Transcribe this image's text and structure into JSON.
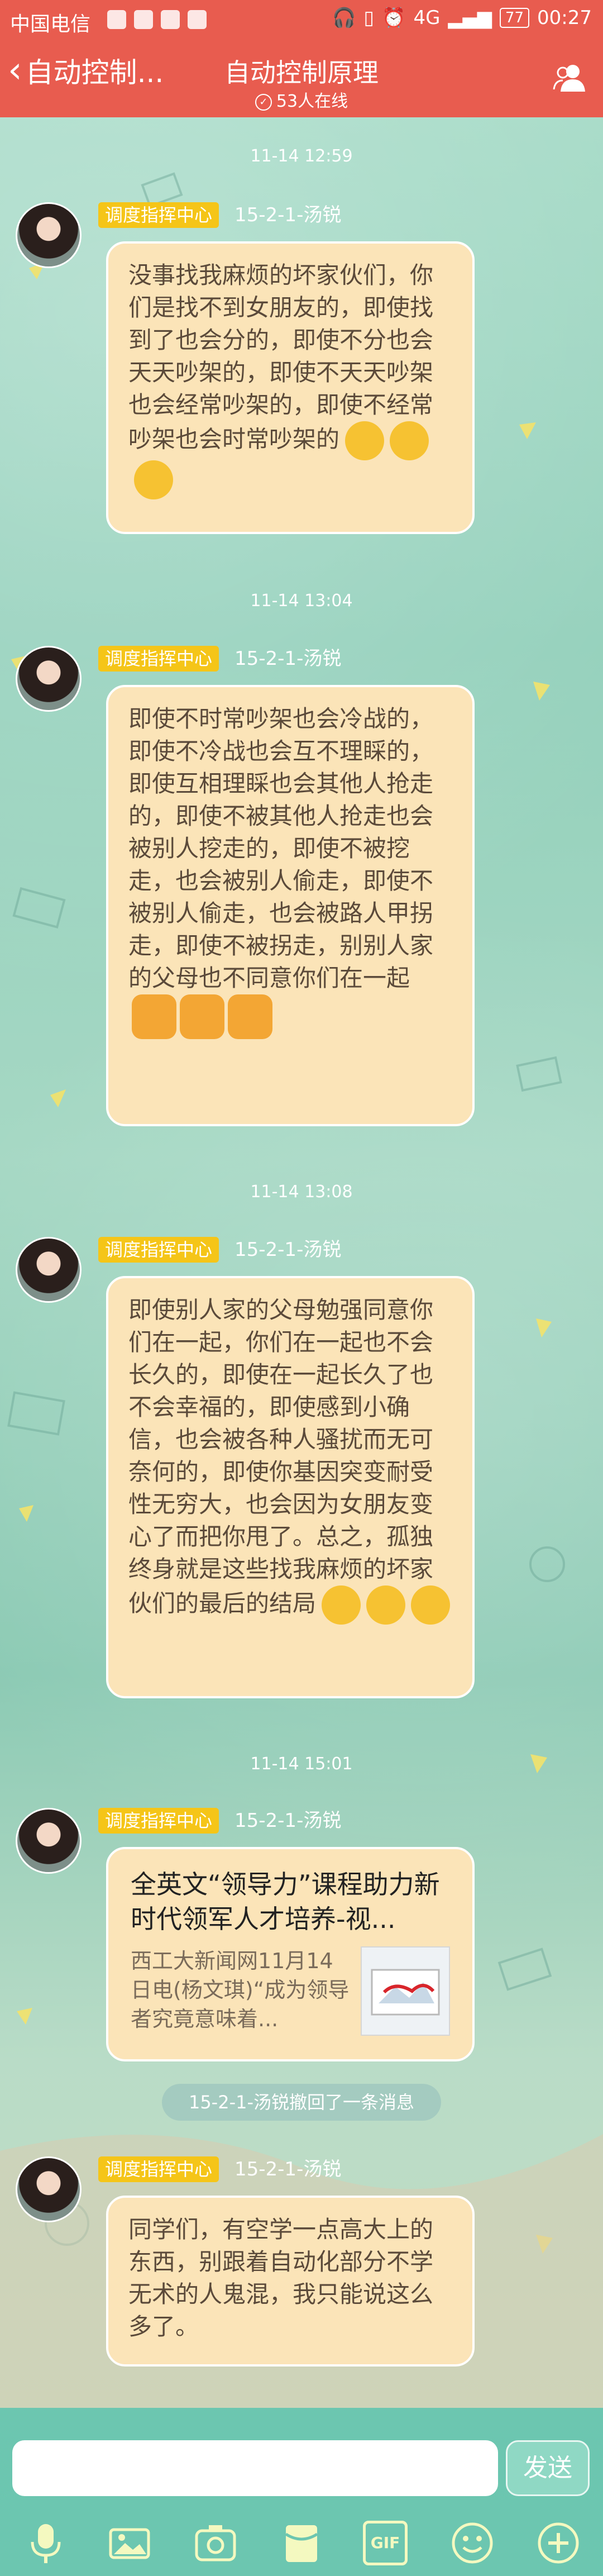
{
  "status_bar": {
    "carrier": "中国电信",
    "network": "4G",
    "battery": "77",
    "time": "00:27"
  },
  "header": {
    "back_label": "自动控制...",
    "title": "自动控制原理",
    "online": "53人在线",
    "member_icon": "group-members-icon"
  },
  "messages": [
    {
      "time": "11-14 12:59",
      "role": "调度指挥中心",
      "sender": "15-2-1-汤锐",
      "text": "没事找我麻烦的坏家伙们，你们是找不到女朋友的，即使找到了也会分的，即使不分也会天天吵架的，即使不天天吵架也会经常吵架的，即使不经常吵架也会时常吵架的"
    },
    {
      "time": "11-14 13:04",
      "role": "调度指挥中心",
      "sender": "15-2-1-汤锐",
      "text": "即使不时常吵架也会冷战的，即使不冷战也会互不理睬的，即使互相理睬也会其他人抢走的，即使不被其他人抢走也会被别人挖走的，即使不被挖走，也会被别人偷走，即使不被别人偷走，也会被路人甲拐走，即使不被拐走，别别人家的父母也不同意你们在一起"
    },
    {
      "time": "11-14 13:08",
      "role": "调度指挥中心",
      "sender": "15-2-1-汤锐",
      "text": "即使别人家的父母勉强同意你们在一起，你们在一起也不会长久的，即使在一起长久了也不会幸福的，即使感到小确信，也会被各种人骚扰而无可奈何的，即使你基因突变耐受性无穷大，也会因为女朋友变心了而把你甩了。总之，孤独终身就是这些找我麻烦的坏家伙们的最后的结局"
    },
    {
      "time": "11-14 15:01",
      "role": "调度指挥中心",
      "sender": "15-2-1-汤锐",
      "link_title": "全英文“领导力”课程助力新时代领军人才培养-视...",
      "link_desc": "西工大新闻网11月14日电(杨文琪)“成为领导者究竟意味着..."
    }
  ],
  "recall_notice": "15-2-1-汤锐撤回了一条消息",
  "last_message": {
    "role": "调度指挥中心",
    "sender": "15-2-1-汤锐",
    "text": "同学们，有空学一点高大上的东西，别跟着自动化部分不学无术的人鬼混，我只能说这么多了。"
  },
  "input": {
    "placeholder": "",
    "send_label": "发送"
  },
  "toolbar": {
    "gif_label": "GIF"
  },
  "colors": {
    "header": "#e85c4f",
    "bubble": "#fbe4b8",
    "role_badge": "#f5c518",
    "input_bar": "#6cc6b0"
  }
}
